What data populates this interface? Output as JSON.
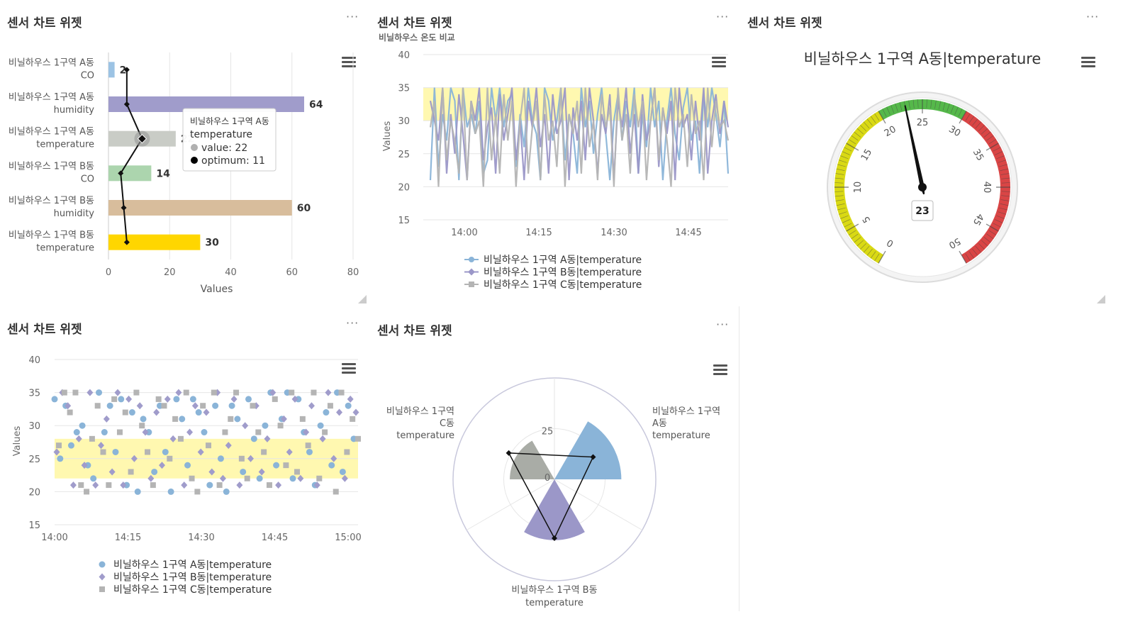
{
  "widgets": {
    "w1": {
      "title": "센서 차트 위젯",
      "more": "···"
    },
    "w2": {
      "title": "센서 차트 위젯",
      "subtitle": "비닐하우스 온도 비교",
      "more": "···"
    },
    "w3": {
      "title": "센서 차트 위젯",
      "more": "···"
    },
    "w4": {
      "title": "센서 차트 위젯",
      "more": "···"
    },
    "w5": {
      "title": "센서 차트 위젯",
      "more": "···"
    }
  },
  "chart_data": [
    {
      "type": "bar",
      "orientation": "horizontal",
      "categories": [
        [
          "비닐하우스 1구역 A동",
          "CO"
        ],
        [
          "비닐하우스 1구역 A동",
          "humidity"
        ],
        [
          "비닐하우스 1구역 A동",
          "temperature"
        ],
        [
          "비닐하우스 1구역 B동",
          "CO"
        ],
        [
          "비닐하우스 1구역 B동",
          "humidity"
        ],
        [
          "비닐하우스 1구역 B동",
          "temperature"
        ]
      ],
      "series": [
        {
          "name": "value",
          "values": [
            2,
            64,
            22,
            14,
            60,
            30
          ]
        },
        {
          "name": "optimum",
          "values": [
            6,
            6,
            11,
            4,
            5,
            6
          ]
        }
      ],
      "bar_colors": [
        "#9cc3e4",
        "#a09ccb",
        "#c9ccc6",
        "#acd5ae",
        "#d8bd9c",
        "#ffd600"
      ],
      "xlabel": "Values",
      "xlim": [
        0,
        80
      ],
      "xticks": [
        "0",
        "20",
        "40",
        "60",
        "80"
      ],
      "tooltip": {
        "title": [
          "비닐하우스 1구역 A동",
          "temperature"
        ],
        "value_text": "value: 22",
        "optimum_text": "optimum: 11"
      }
    },
    {
      "type": "line",
      "x": [
        "14:00",
        "14:15",
        "14:30",
        "14:45"
      ],
      "ylabel": "Values",
      "ylim": [
        15,
        40
      ],
      "yticks": [
        "15",
        "20",
        "25",
        "30",
        "35",
        "40"
      ],
      "band": [
        30,
        35
      ],
      "series": [
        {
          "name": "비닐하우스 1구역 A동|temperature",
          "color": "#8ab4d8",
          "values": [
            21,
            35,
            23,
            31,
            27,
            35,
            33,
            21,
            35,
            29,
            31,
            28,
            33,
            22,
            24,
            35,
            30,
            35,
            29,
            33,
            34,
            23,
            31,
            26,
            35,
            30,
            28,
            21,
            35,
            33,
            27,
            30,
            35,
            24,
            31,
            28,
            22,
            35,
            29,
            33,
            25,
            31,
            35,
            28,
            21,
            30,
            34,
            27,
            33,
            29,
            35,
            22,
            31,
            26,
            35,
            29,
            33,
            21,
            30,
            35,
            28,
            24,
            32,
            35,
            27,
            30,
            22,
            34,
            29,
            35,
            31,
            26,
            33,
            22
          ]
        },
        {
          "name": "비닐하우스 1구역 B동|temperature",
          "color": "#9b97c8",
          "values": [
            33,
            30,
            27,
            35,
            22,
            31,
            25,
            34,
            28,
            21,
            33,
            30,
            35,
            24,
            29,
            32,
            22,
            34,
            27,
            31,
            35,
            24,
            30,
            21,
            33,
            29,
            35,
            26,
            31,
            22,
            34,
            28,
            30,
            35,
            21,
            32,
            27,
            33,
            24,
            35,
            30,
            22,
            31,
            28,
            34,
            21,
            33,
            29,
            35,
            25,
            31,
            22,
            34,
            27,
            30,
            35,
            23,
            32,
            28,
            33,
            21,
            35,
            29,
            31,
            24,
            33,
            27,
            35,
            22,
            30,
            34,
            28,
            33,
            29
          ]
        },
        {
          "name": "비닐하우스 1구역 C동|temperature",
          "color": "#b4b4b4",
          "values": [
            29,
            33,
            20,
            35,
            24,
            30,
            27,
            22,
            35,
            21,
            33,
            28,
            30,
            20,
            35,
            24,
            31,
            22,
            34,
            27,
            33,
            20,
            30,
            35,
            22,
            29,
            33,
            21,
            34,
            27,
            30,
            23,
            35,
            20,
            31,
            28,
            33,
            22,
            35,
            26,
            30,
            21,
            34,
            29,
            32,
            20,
            35,
            27,
            31,
            22,
            34,
            29,
            33,
            21,
            30,
            35,
            24,
            32,
            27,
            20,
            35,
            29,
            31,
            23,
            34,
            28,
            30,
            21,
            35,
            26,
            33,
            29,
            30,
            27
          ]
        }
      ]
    },
    {
      "type": "gauge",
      "title": "비닐하우스 1구역 A동|temperature",
      "value": 23,
      "min": 0,
      "max": 50,
      "ticks": [
        "0",
        "5",
        "10",
        "15",
        "20",
        "25",
        "30",
        "35",
        "40",
        "45",
        "50"
      ],
      "bands": [
        {
          "from": 0,
          "to": 20,
          "color": "#d9d914"
        },
        {
          "from": 20,
          "to": 30,
          "color": "#55b84a"
        },
        {
          "from": 30,
          "to": 50,
          "color": "#d94545"
        }
      ],
      "value_label": "23"
    },
    {
      "type": "scatter",
      "x": [
        "14:00",
        "14:15",
        "14:30",
        "14:45",
        "15:00"
      ],
      "ylabel": "Values",
      "ylim": [
        15,
        40
      ],
      "yticks": [
        "15",
        "20",
        "25",
        "30",
        "35",
        "40"
      ],
      "band": [
        22,
        28
      ],
      "series": [
        {
          "name": "비닐하우스 1구역 A동|temperature",
          "color": "#8ab4d8",
          "marker": "circle",
          "values": [
            34,
            25,
            33,
            27,
            29,
            30,
            24,
            22,
            35,
            29,
            33,
            26,
            34,
            21,
            32,
            20,
            31,
            29,
            23,
            33,
            26,
            20,
            34,
            31,
            24,
            34,
            32,
            29,
            21,
            33,
            25,
            20,
            33,
            31,
            23,
            34,
            28,
            22,
            30,
            35,
            24,
            31,
            35,
            22,
            34,
            29,
            26,
            21,
            30,
            32,
            24,
            35,
            23,
            33,
            28
          ]
        },
        {
          "name": "비닐하우스 1구역 B동|temperature",
          "color": "#a09ccb",
          "marker": "diamond",
          "values": [
            26,
            35,
            33,
            21,
            28,
            24,
            35,
            21,
            27,
            31,
            23,
            35,
            21,
            34,
            25,
            33,
            29,
            22,
            32,
            24,
            34,
            28,
            35,
            21,
            29,
            33,
            26,
            32,
            23,
            35,
            22,
            27,
            34,
            21,
            30,
            25,
            33,
            23,
            28,
            35,
            21,
            31,
            26,
            34,
            22,
            29,
            33,
            21,
            28,
            35,
            25,
            32,
            22,
            34,
            32
          ]
        },
        {
          "name": "비닐하우스 1구역 C동|temperature",
          "color": "#b4b4b4",
          "marker": "square",
          "values": [
            27,
            35,
            32,
            35,
            21,
            20,
            28,
            33,
            26,
            21,
            34,
            29,
            32,
            23,
            35,
            30,
            26,
            21,
            34,
            33,
            25,
            31,
            28,
            35,
            22,
            20,
            33,
            27,
            35,
            21,
            29,
            31,
            35,
            25,
            22,
            33,
            29,
            26,
            21,
            34,
            30,
            24,
            35,
            23,
            31,
            27,
            35,
            22,
            29,
            33,
            20,
            35,
            26,
            31,
            28
          ]
        }
      ]
    },
    {
      "type": "polar_bar",
      "categories": [
        [
          "비닐하우스 1구역 A동",
          "temperature"
        ],
        [
          "비닐하우스 1구역 B동",
          "temperature"
        ],
        [
          "비닐하우스 1구역 C동",
          "temperature"
        ]
      ],
      "values": [
        33,
        30,
        22
      ],
      "optimum": [
        22,
        29,
        26
      ],
      "colors": [
        "#8ab4d8",
        "#9b97c8",
        "#a9aca6"
      ],
      "rticks": [
        "0",
        "25"
      ],
      "rmax": 50
    }
  ]
}
